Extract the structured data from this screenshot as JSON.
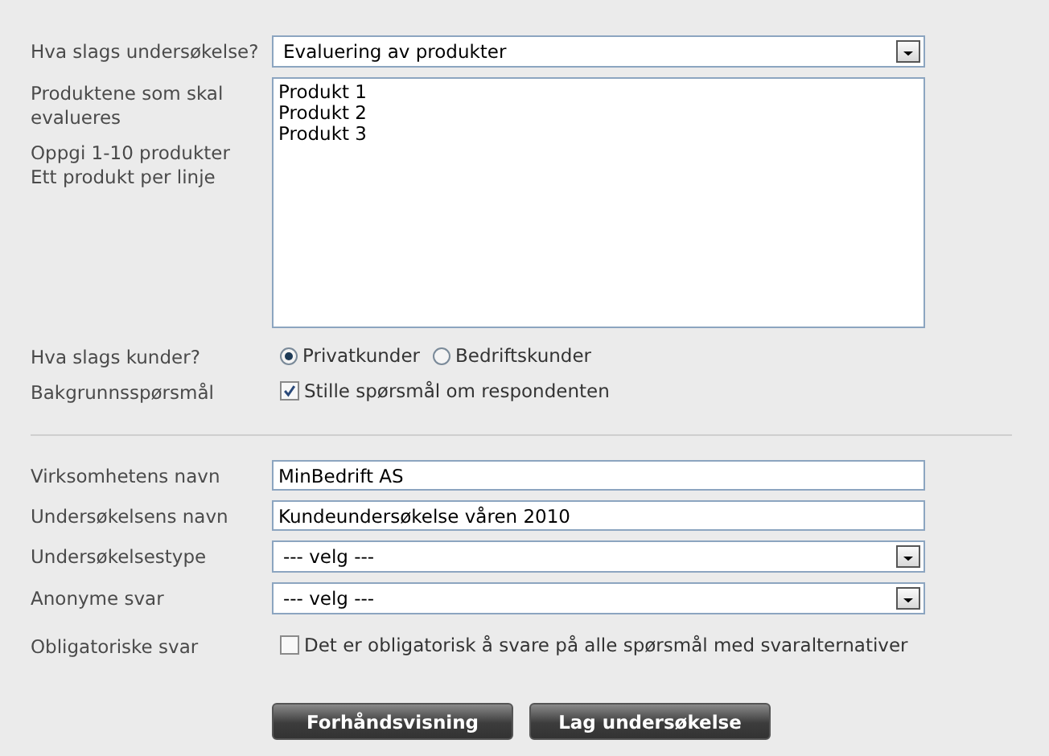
{
  "survey": [
    {
      "kind": "select",
      "label": "Hva slags undersøkelse?",
      "value": "Evaluering av produkter"
    },
    {
      "kind": "textarea",
      "label": "Produktene som skal evalueres",
      "hint_lines": [
        "Oppgi 1-10 produkter",
        "Ett produkt per linje"
      ],
      "value": "Produkt 1\nProdukt 2\nProdukt 3"
    },
    {
      "kind": "radio",
      "label": "Hva slags kunder?",
      "options": [
        {
          "label": "Privatkunder",
          "selected": true
        },
        {
          "label": "Bedriftskunder",
          "selected": false
        }
      ]
    },
    {
      "kind": "checkbox",
      "label": "Bakgrunnsspørsmål",
      "option": "Stille spørsmål om respondenten",
      "checked": true
    }
  ],
  "details": [
    {
      "kind": "input",
      "label": "Virksomhetens navn",
      "value": "MinBedrift AS"
    },
    {
      "kind": "input",
      "label": "Undersøkelsens navn",
      "value": "Kundeundersøkelse våren 2010"
    },
    {
      "kind": "select",
      "label": "Undersøkelsestype",
      "value": "--- velg ---"
    },
    {
      "kind": "select",
      "label": "Anonyme svar",
      "value": "--- velg ---"
    },
    {
      "kind": "checkbox",
      "label": "Obligatoriske svar",
      "option": "Det er obligatorisk å svare på alle spørsmål med svaralternativer",
      "checked": false
    }
  ],
  "buttons": [
    "Forhåndsvisning",
    "Lag undersøkelse"
  ]
}
